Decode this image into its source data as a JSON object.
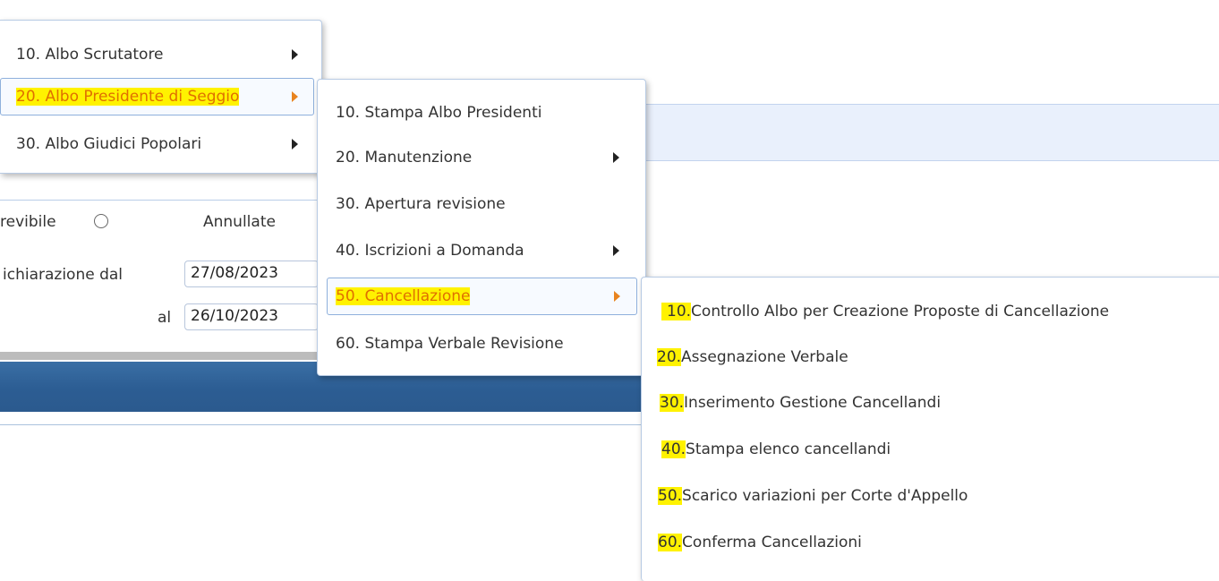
{
  "background": {
    "filters": {
      "option_left_label": "revibile",
      "option_right_label": "Annullate",
      "date_from_label": "ichiarazione dal",
      "date_from_value": "27/08/2023",
      "date_to_label": "al",
      "date_to_value": "26/10/2023"
    }
  },
  "menu_level1": {
    "items": [
      {
        "label": "10. Albo Scrutatore",
        "has_submenu": true
      },
      {
        "label": "20. Albo Presidente di Seggio",
        "has_submenu": true,
        "active": true
      },
      {
        "label": "30. Albo Giudici Popolari",
        "has_submenu": true
      }
    ]
  },
  "menu_level2": {
    "items": [
      {
        "label": "10. Stampa Albo Presidenti",
        "has_submenu": false
      },
      {
        "label": "20. Manutenzione",
        "has_submenu": true
      },
      {
        "label": "30. Apertura revisione",
        "has_submenu": false
      },
      {
        "label": "40. Iscrizioni a Domanda",
        "has_submenu": true
      },
      {
        "label": "50. Cancellazione",
        "has_submenu": true,
        "active": true
      },
      {
        "label": "60. Stampa Verbale Revisione",
        "has_submenu": false
      }
    ]
  },
  "menu_level3": {
    "items": [
      {
        "number": "10.",
        "label": " Controllo Albo per Creazione Proposte di Cancellazione"
      },
      {
        "number": "20.",
        "label": " Assegnazione Verbale"
      },
      {
        "number": "30.",
        "label": " Inserimento Gestione Cancellandi"
      },
      {
        "number": "40.",
        "label": " Stampa elenco cancellandi"
      },
      {
        "number": "50.",
        "label": " Scarico variazioni per Corte d'Appello"
      },
      {
        "number": "60.",
        "label": " Conferma Cancellazioni"
      }
    ]
  },
  "colors": {
    "highlight": "#fff200",
    "active_text": "#e07000",
    "toolbar_blue": "#2c5d93"
  }
}
